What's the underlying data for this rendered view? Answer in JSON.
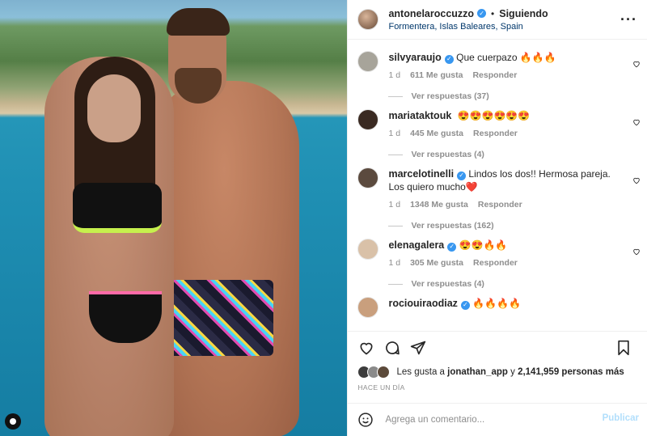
{
  "post": {
    "author": "antonelaroccuzzo",
    "follow_status": "Siguiendo",
    "separator": "•",
    "location": "Formentera, Islas Baleares, Spain",
    "more_icon": "more-horizontal-icon"
  },
  "comments": [
    {
      "user": "silvyaraujo",
      "text": "Que cuerpazo 🔥🔥🔥",
      "time": "1 d",
      "likes": "611 Me gusta",
      "reply": "Responder",
      "replies": "Ver respuestas (37)",
      "avatar_color": "#a7a49a"
    },
    {
      "user": "mariataktouk",
      "text": "😍😍😍😍😍😍",
      "time": "1 d",
      "likes": "445 Me gusta",
      "reply": "Responder",
      "replies": "Ver respuestas (4)",
      "avatar_color": "#3a2a22"
    },
    {
      "user": "marcelotinelli",
      "text": "Lindos los dos!! Hermosa pareja. Los quiero mucho❤️",
      "time": "1 d",
      "likes": "1348 Me gusta",
      "reply": "Responder",
      "replies": "Ver respuestas (162)",
      "avatar_color": "#5b4a3e"
    },
    {
      "user": "elenagalera",
      "text": "😍😍🔥🔥",
      "time": "1 d",
      "likes": "305 Me gusta",
      "reply": "Responder",
      "replies": "Ver respuestas (4)",
      "avatar_color": "#d9c1a8"
    },
    {
      "user": "rociouiraodiaz",
      "text": "🔥🔥🔥🔥",
      "time": "",
      "likes": "",
      "reply": "",
      "replies": "",
      "avatar_color": "#c99f7d"
    }
  ],
  "likes": {
    "prefix": "Les gusta a",
    "user": "jonathan_app",
    "connector": "y",
    "count": "2,141,959 personas más"
  },
  "timestamp": "HACE UN DÍA",
  "composer": {
    "placeholder": "Agrega un comentario...",
    "publish": "Publicar"
  },
  "colors": {
    "verified": "#3897f0",
    "link": "#00376b",
    "publish_disabled": "#b2dffc",
    "muted": "#8e8e8e"
  }
}
